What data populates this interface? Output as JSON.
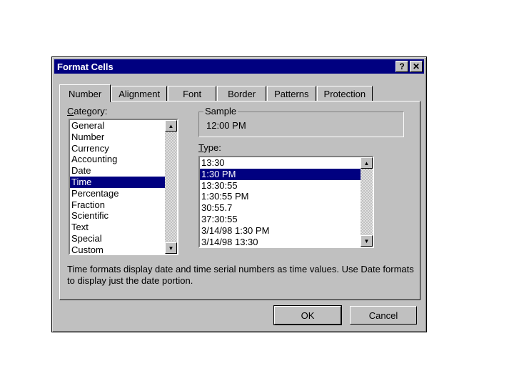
{
  "dialog": {
    "title": "Format Cells",
    "help_button": "?",
    "close_button": "✕"
  },
  "tabs": [
    "Number",
    "Alignment",
    "Font",
    "Border",
    "Patterns",
    "Protection"
  ],
  "category": {
    "label_prefix": "C",
    "label_rest": "ategory:",
    "items": [
      "General",
      "Number",
      "Currency",
      "Accounting",
      "Date",
      "Time",
      "Percentage",
      "Fraction",
      "Scientific",
      "Text",
      "Special",
      "Custom"
    ],
    "selected": "Time"
  },
  "sample": {
    "label": "Sample",
    "value": "12:00 PM"
  },
  "type": {
    "label_prefix": "T",
    "label_rest": "ype:",
    "items": [
      "13:30",
      "1:30 PM",
      "13:30:55",
      "1:30:55 PM",
      "30:55.7",
      "37:30:55",
      "3/14/98 1:30 PM",
      "3/14/98 13:30"
    ],
    "selected": "1:30 PM"
  },
  "description": "Time formats display date and time serial numbers as time values.  Use Date formats to display just the date portion.",
  "buttons": {
    "ok": "OK",
    "cancel": "Cancel"
  }
}
